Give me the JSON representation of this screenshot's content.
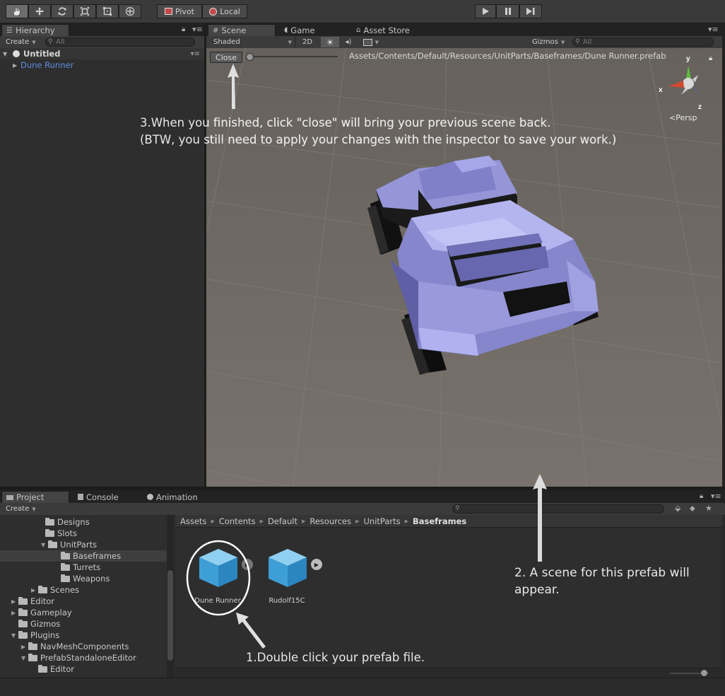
{
  "toolbar": {
    "pivot_label": "Pivot",
    "local_label": "Local"
  },
  "hierarchy": {
    "tab_label": "Hierarchy",
    "create_label": "Create",
    "search_placeholder": "All",
    "scene_name": "Untitled",
    "items": [
      "Dune Runner"
    ]
  },
  "scene_tabs": {
    "scene_label": "Scene",
    "game_label": "Game",
    "asset_store_label": "Asset Store"
  },
  "scene_controls": {
    "shading_mode": "Shaded",
    "mode_2d": "2D",
    "gizmos_label": "Gizmos",
    "search_placeholder": "All",
    "close_label": "Close",
    "prefab_path": "Assets/Contents/Default/Resources/UnitParts/Baseframes/Dune Runner.prefab",
    "persp_label": "Persp",
    "axis_y": "y",
    "axis_x": "x",
    "axis_z": "z"
  },
  "annotations": {
    "step3_line1": "3.When you finished, click \"close\" will bring your previous scene back.",
    "step3_line2": "(BTW, you still need to apply your changes with the inspector to save your work.)",
    "step2_line1": "2. A scene for this prefab will",
    "step2_line2": "appear.",
    "step1": "1.Double click your prefab file."
  },
  "project_tabs": {
    "project_label": "Project",
    "console_label": "Console",
    "animation_label": "Animation",
    "create_label": "Create"
  },
  "project_tree": [
    {
      "label": "Designs",
      "arrow": ""
    },
    {
      "label": "Slots",
      "arrow": ""
    },
    {
      "label": "UnitParts",
      "arrow": "▼"
    },
    {
      "label": "Baseframes",
      "arrow": ""
    },
    {
      "label": "Turrets",
      "arrow": ""
    },
    {
      "label": "Weapons",
      "arrow": ""
    },
    {
      "label": "Scenes",
      "arrow": "▶"
    },
    {
      "label": "Editor",
      "arrow": "▶"
    },
    {
      "label": "Gameplay",
      "arrow": "▶"
    },
    {
      "label": "Gizmos",
      "arrow": ""
    },
    {
      "label": "Plugins",
      "arrow": "▼"
    },
    {
      "label": "NavMeshComponents",
      "arrow": "▶"
    },
    {
      "label": "PrefabStandaloneEditor",
      "arrow": "▼"
    },
    {
      "label": "Editor",
      "arrow": ""
    }
  ],
  "breadcrumb": [
    "Assets",
    "Contents",
    "Default",
    "Resources",
    "UnitParts",
    "Baseframes"
  ],
  "assets": [
    {
      "name": "Dune Runner"
    },
    {
      "name": "Rudolf15C"
    }
  ],
  "colors": {
    "accent_blue": "#5f8ee0",
    "selected_row": "#3e3e3e",
    "cube_blue": "#4aa8db",
    "vehicle_purple": "#9b9ce0",
    "scene_ground": "#6e6762"
  }
}
